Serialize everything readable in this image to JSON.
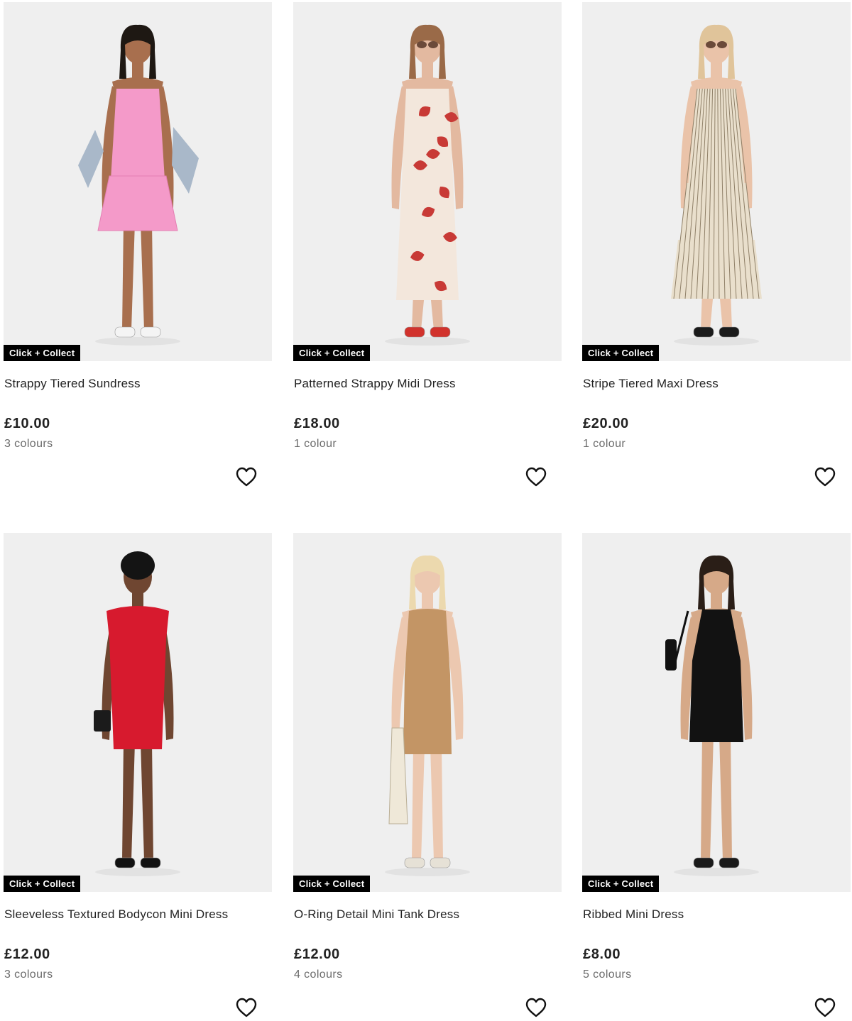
{
  "products": [
    {
      "name": "Strappy Tiered Sundress",
      "price": "£10.00",
      "colours": "3 colours",
      "badge": "Click + Collect",
      "dress_color": "#f49ac9",
      "skin": "#a86f4e",
      "hair": "#1e1813",
      "shoe": "#f4f4f4",
      "style": "tiered-mini",
      "extra": "denim-jacket",
      "jacket_color": "#a9b8c9",
      "icon": "heart-outline-icon"
    },
    {
      "name": "Patterned Strappy Midi Dress",
      "price": "£18.00",
      "colours": "1 colour",
      "badge": "Click + Collect",
      "dress_color": "#f3e7dc",
      "pattern_color": "#c83a36",
      "skin": "#e3b9a0",
      "hair": "#9a6a48",
      "shoe": "#d1322c",
      "style": "midi-print",
      "extra": "sunglasses",
      "icon": "heart-outline-icon"
    },
    {
      "name": "Stripe Tiered Maxi Dress",
      "price": "£20.00",
      "colours": "1 colour",
      "badge": "Click + Collect",
      "dress_color": "#e9dfcc",
      "stripe_color": "#8f8068",
      "skin": "#eac3a9",
      "hair": "#e0c49a",
      "shoe": "#1a1a1a",
      "style": "tiered-maxi",
      "extra": "sunglasses",
      "icon": "heart-outline-icon"
    },
    {
      "name": "Sleeveless Textured Bodycon Mini Dress",
      "price": "£12.00",
      "colours": "3 colours",
      "badge": "Click + Collect",
      "dress_color": "#d71a2e",
      "skin": "#6f4631",
      "hair": "#141414",
      "shoe": "#111111",
      "style": "bodycon-cap",
      "extra": "clutch",
      "icon": "heart-outline-icon"
    },
    {
      "name": "O-Ring Detail Mini Tank Dress",
      "price": "£12.00",
      "colours": "4 colours",
      "badge": "Click + Collect",
      "dress_color": "#c39565",
      "skin": "#ecc8b0",
      "hair": "#ecd9ae",
      "shoe": "#e6e1d6",
      "style": "tank-mini",
      "extra": "net-bag",
      "icon": "heart-outline-icon"
    },
    {
      "name": "Ribbed Mini Dress",
      "price": "£8.00",
      "colours": "5 colours",
      "badge": "Click + Collect",
      "dress_color": "#121212",
      "skin": "#d6a988",
      "hair": "#2a1e17",
      "shoe": "#1a1a1a",
      "style": "halter-mini",
      "extra": "shoulder-bag",
      "icon": "heart-outline-icon"
    }
  ]
}
